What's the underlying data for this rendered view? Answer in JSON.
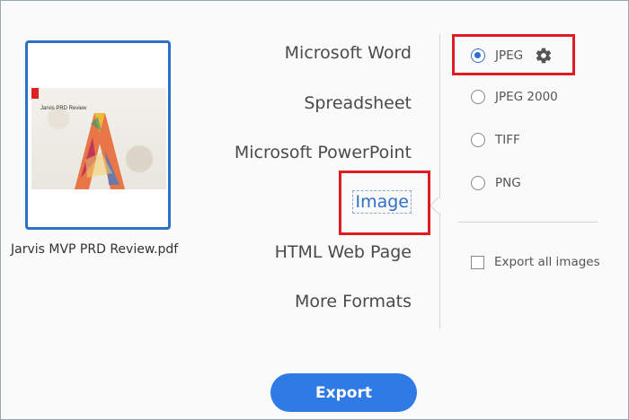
{
  "document": {
    "thumbnail_headline": "Jarvis PRD Review",
    "file_name": "Jarvis MVP PRD Review.pdf"
  },
  "formats": [
    {
      "label": "Microsoft Word",
      "selected": false
    },
    {
      "label": "Spreadsheet",
      "selected": false
    },
    {
      "label": "Microsoft PowerPoint",
      "selected": false
    },
    {
      "label": "Image",
      "selected": true
    },
    {
      "label": "HTML Web Page",
      "selected": false
    },
    {
      "label": "More Formats",
      "selected": false
    }
  ],
  "image_options": [
    {
      "label": "JPEG",
      "selected": true
    },
    {
      "label": "JPEG 2000",
      "selected": false
    },
    {
      "label": "TIFF",
      "selected": false
    },
    {
      "label": "PNG",
      "selected": false
    }
  ],
  "export_all_images": {
    "label": "Export all images",
    "checked": false
  },
  "export_button": {
    "label": "Export"
  },
  "colors": {
    "accent": "#2f6fc7",
    "button": "#2f7ae5",
    "highlight": "#e01b22"
  },
  "icons": {
    "settings": "gear-icon"
  }
}
